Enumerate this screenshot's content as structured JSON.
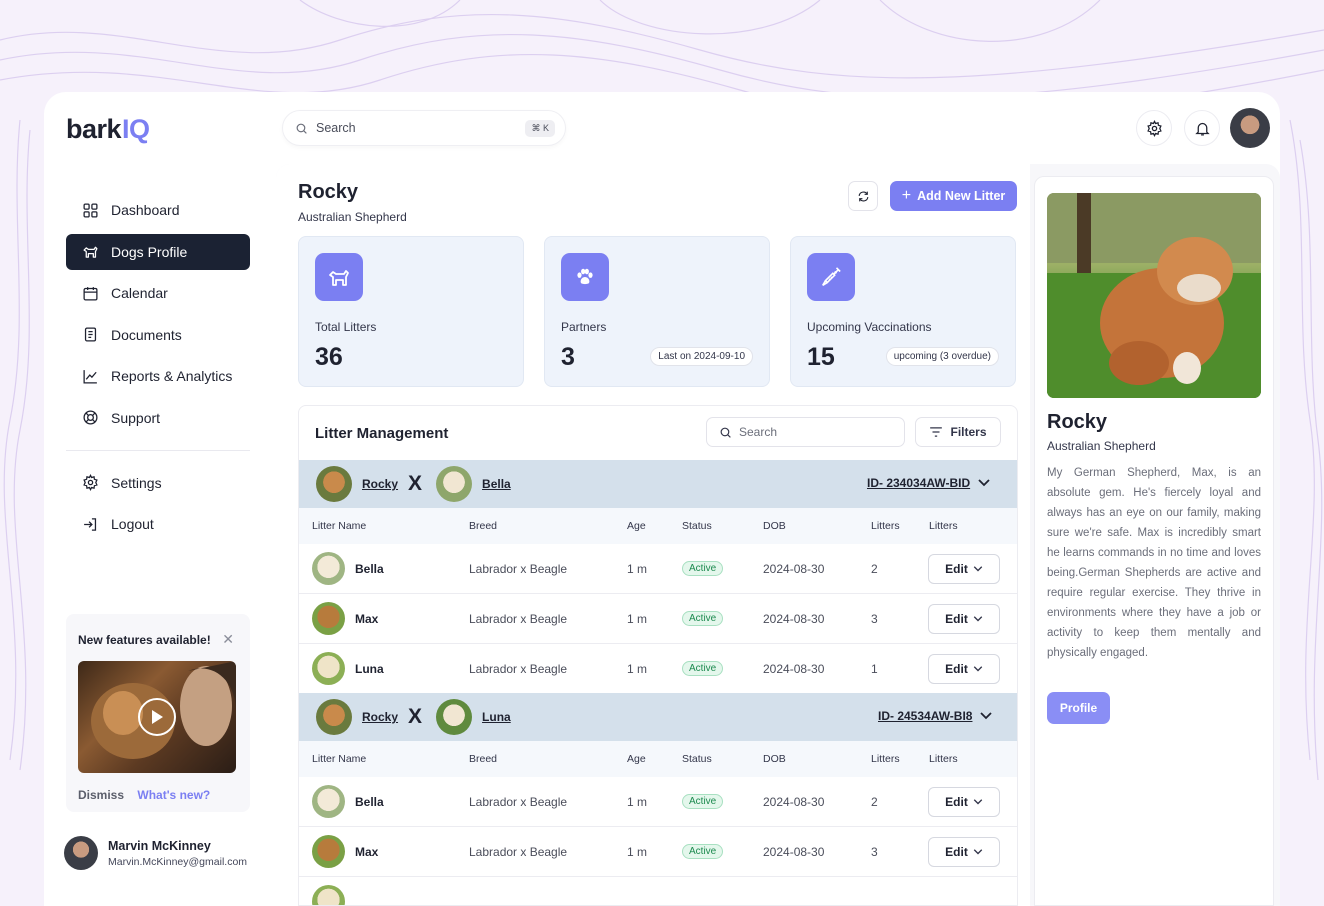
{
  "app": {
    "logo_text": "bark",
    "logo_accent": "IQ",
    "accent_color": "#7b7ff2"
  },
  "sidebar": {
    "items": [
      {
        "label": "Dashboard",
        "icon": "grid-icon"
      },
      {
        "label": "Dogs Profile",
        "icon": "dog-icon",
        "active": true
      },
      {
        "label": "Calendar",
        "icon": "calendar-icon"
      },
      {
        "label": "Documents",
        "icon": "document-icon"
      },
      {
        "label": "Reports & Analytics",
        "icon": "chart-line-icon"
      },
      {
        "label": "Support",
        "icon": "lifebuoy-icon"
      }
    ],
    "bottom_items": [
      {
        "label": "Settings",
        "icon": "gear-icon"
      },
      {
        "label": "Logout",
        "icon": "logout-icon"
      }
    ],
    "promo": {
      "title": "New features available!",
      "dismiss": "Dismiss",
      "whats_new": "What's new?"
    },
    "user": {
      "name": "Marvin McKinney",
      "email": "Marvin.McKinney@gmail.com"
    }
  },
  "topbar": {
    "search_placeholder": "Search",
    "shortcut": "⌘ K"
  },
  "header": {
    "title": "Rocky",
    "subtitle": "Australian Shepherd",
    "add_button": "Add New Litter"
  },
  "stats": [
    {
      "label": "Total Litters",
      "value": "36",
      "badge": "",
      "icon": "dog-icon"
    },
    {
      "label": "Partners",
      "value": "3",
      "badge": "Last on 2024-09-10",
      "icon": "paw-icon"
    },
    {
      "label": "Upcoming Vaccinations",
      "value": "15",
      "badge": "upcoming (3 overdue)",
      "icon": "syringe-icon"
    }
  ],
  "litter": {
    "title": "Litter Management",
    "search_placeholder": "Search",
    "filters_label": "Filters",
    "columns": [
      "Litter Name",
      "Breed",
      "Age",
      "Status",
      "DOB",
      "Litters",
      "Litters"
    ],
    "edit_label": "Edit",
    "groups": [
      {
        "sire": "Rocky",
        "dam": "Bella",
        "x": "X",
        "id": "ID- 234034AW-BID",
        "rows": [
          {
            "name": "Bella",
            "breed": "Labrador x Beagle",
            "age": "1 m",
            "status": "Active",
            "dob": "2024-08-30",
            "litters": "2"
          },
          {
            "name": "Max",
            "breed": "Labrador x Beagle",
            "age": "1 m",
            "status": "Active",
            "dob": "2024-08-30",
            "litters": "3"
          },
          {
            "name": "Luna",
            "breed": "Labrador x Beagle",
            "age": "1 m",
            "status": "Active",
            "dob": "2024-08-30",
            "litters": "1"
          }
        ]
      },
      {
        "sire": "Rocky",
        "dam": "Luna",
        "x": "X",
        "id": "ID- 24534AW-BI8",
        "rows": [
          {
            "name": "Bella",
            "breed": "Labrador x Beagle",
            "age": "1 m",
            "status": "Active",
            "dob": "2024-08-30",
            "litters": "2"
          },
          {
            "name": "Max",
            "breed": "Labrador x Beagle",
            "age": "1 m",
            "status": "Active",
            "dob": "2024-08-30",
            "litters": "3"
          }
        ]
      }
    ]
  },
  "profile": {
    "name": "Rocky",
    "breed": "Australian Shepherd",
    "description": "My German Shepherd, Max, is an absolute gem. He's fiercely loyal and always has an eye on our family, making sure we're safe. Max is incredibly smart he learns commands in no time and loves being.German Shepherds are active and require regular exercise. They thrive in environments where they have a job or activity to keep them mentally and physically engaged.",
    "button": "Profile"
  }
}
